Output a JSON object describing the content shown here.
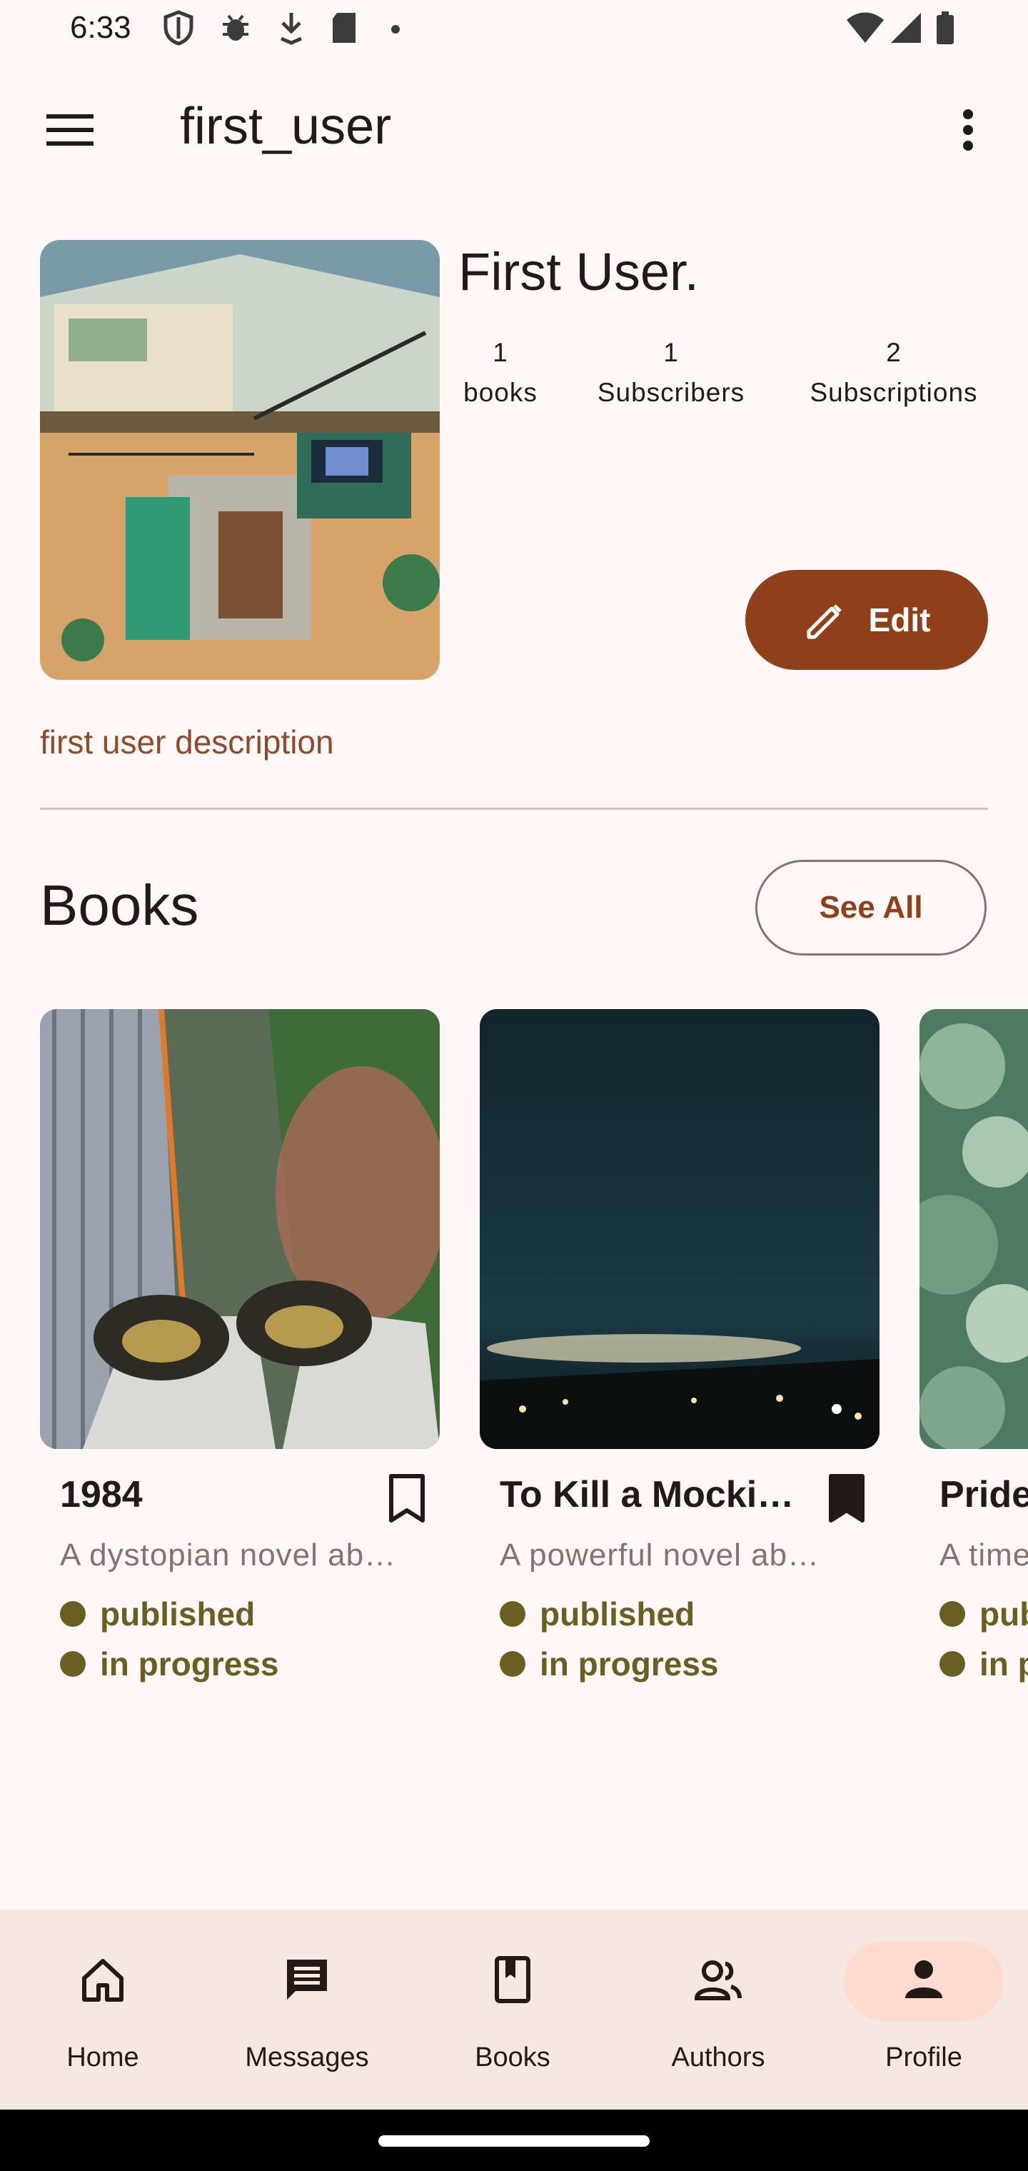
{
  "status_bar": {
    "time": "6:33"
  },
  "app_bar": {
    "title": "first_user"
  },
  "profile": {
    "name": "First User.",
    "stats": [
      {
        "value": "1",
        "label": "books"
      },
      {
        "value": "1",
        "label": "Subscribers"
      },
      {
        "value": "2",
        "label": "Subscriptions"
      }
    ],
    "edit_label": "Edit",
    "description": "first user description"
  },
  "books_section": {
    "title": "Books",
    "see_all_label": "See All",
    "books": [
      {
        "title": "1984",
        "description": "A dystopian novel ab…",
        "status1": "published",
        "status2": "in progress",
        "bookmarked": false
      },
      {
        "title": "To Kill a Mocki…",
        "description": "A powerful novel ab…",
        "status1": "published",
        "status2": "in progress",
        "bookmarked": true
      },
      {
        "title": "Pride",
        "description": "A time",
        "status1": "pub",
        "status2": "in p",
        "bookmarked": false
      }
    ]
  },
  "bottom_nav": {
    "items": [
      {
        "label": "Home",
        "icon": "home-icon"
      },
      {
        "label": "Messages",
        "icon": "messages-icon"
      },
      {
        "label": "Books",
        "icon": "book-icon"
      },
      {
        "label": "Authors",
        "icon": "people-icon"
      },
      {
        "label": "Profile",
        "icon": "person-icon",
        "selected": true
      }
    ]
  },
  "colors": {
    "accent": "#8f3f1a",
    "nav_selected": "#ffdbd0",
    "status_dot": "#6b5e22"
  }
}
